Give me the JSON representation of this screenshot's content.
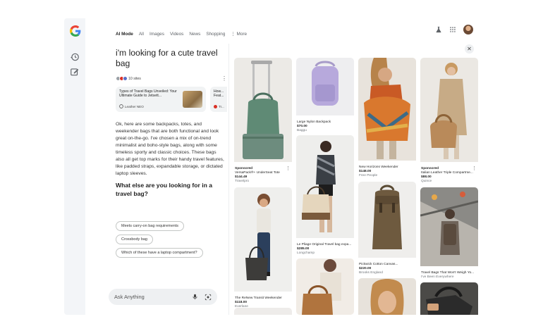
{
  "nav": {
    "tabs": [
      "AI Mode",
      "All",
      "Images",
      "Videos",
      "News",
      "Shopping"
    ],
    "more": "More"
  },
  "query": "i'm looking for a cute travel bag",
  "sites_count": "10 sites",
  "source_cards": [
    {
      "title": "Types of Travel Bags Unveiled: Your Ultimate Guide to Jetsett...",
      "source": "Leather NEO"
    },
    {
      "title": "How... Feat...",
      "source": "Tr..."
    }
  ],
  "answer": "Ok, here are some backpacks, totes, and weekender bags that are both functional and look great on-the-go. I've chosen a mix of on-trend minimalist and boho-style bags, along with some timeless sporty and classic choices. These bags also all get top marks for their handy travel features, like padded straps, expandable storage, or dictated laptop sleeves.",
  "followup_question": "What else are you looking for in a travel bag?",
  "chips": [
    "Meets carry-on bag requirements",
    "Crossbody bag",
    "Which of these have a laptop compartment?"
  ],
  "ask_placeholder": "Ask Anything",
  "products": {
    "col1": [
      {
        "sponsored": "Sponsored",
        "name": "VersaPack®+ UnderSeat Tote",
        "price": "$144.49",
        "source": "Travelpro"
      },
      {
        "name": "The ReNew Transit Weekender",
        "price": "$118.00",
        "source": "Everlane"
      }
    ],
    "col2": [
      {
        "name": "Large Nylon Backpack",
        "price": "$70.00",
        "source": "Baggu"
      },
      {
        "name": "Le Pliage Original Travel bag expa...",
        "price": "$285.00",
        "source": "Longchamp"
      }
    ],
    "col3": [
      {
        "name": "New Horizons Weekender",
        "price": "$148.00",
        "source": "Free People"
      },
      {
        "name": "Pickwick Cotton Canvas...",
        "price": "$220.00",
        "source": "Brooks England"
      }
    ],
    "col4": [
      {
        "sponsored": "Sponsored",
        "name": "Italian Leather Triple Compartme...",
        "price": "$88.00",
        "source": "Quince"
      },
      {
        "name": "Travel Bags That Won't Weigh Yo...",
        "source": "I've Been Everywhere"
      }
    ]
  },
  "colors": {
    "accent": "#1a73e8",
    "rail": "#f3f5f8",
    "chip_border": "#c4c7c5"
  }
}
